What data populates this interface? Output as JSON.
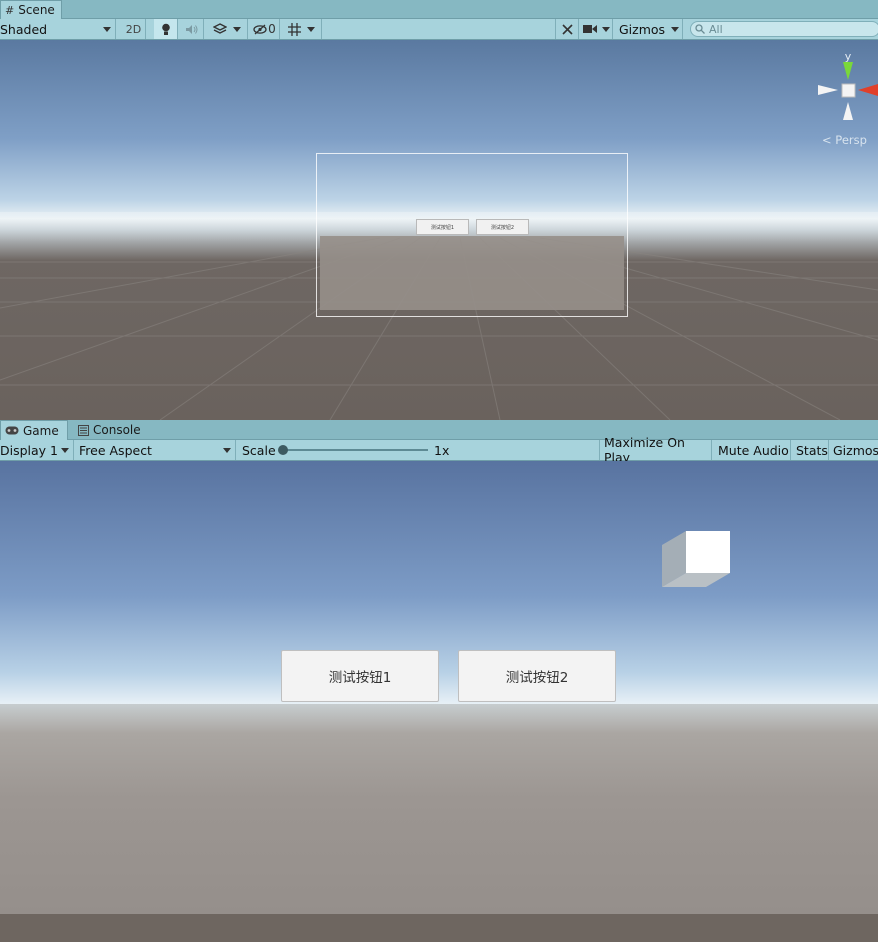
{
  "scene_panel": {
    "tab": {
      "label": "Scene",
      "icon": "grid-icon"
    },
    "toolbar": {
      "draw_mode": "Shaded",
      "mode_2d": "2D",
      "hidden_count": "0",
      "gizmos_label": "Gizmos",
      "search_placeholder": "All"
    },
    "ui_buttons": [
      "测试按钮1",
      "测试按钮2"
    ],
    "gizmo": {
      "y_axis": "y",
      "projection": "< Persp"
    }
  },
  "game_panel": {
    "tabs": [
      {
        "label": "Game",
        "icon": "gamepad-icon"
      },
      {
        "label": "Console",
        "icon": "console-icon"
      }
    ],
    "toolbar": {
      "display": "Display 1",
      "aspect": "Free Aspect",
      "scale_label": "Scale",
      "scale_value": "1x",
      "maximize_on_play": "Maximize On Play",
      "mute_audio": "Mute Audio",
      "stats": "Stats",
      "gizmos": "Gizmos"
    },
    "buttons": [
      {
        "label": "测试按钮1"
      },
      {
        "label": "测试按钮2"
      }
    ]
  },
  "colors": {
    "editor_tint": "#a7d3dc",
    "sky_top": "#5a79a0",
    "ground": "#958f8b",
    "axis_x": "#e0402a",
    "axis_y": "#7ad83a"
  }
}
